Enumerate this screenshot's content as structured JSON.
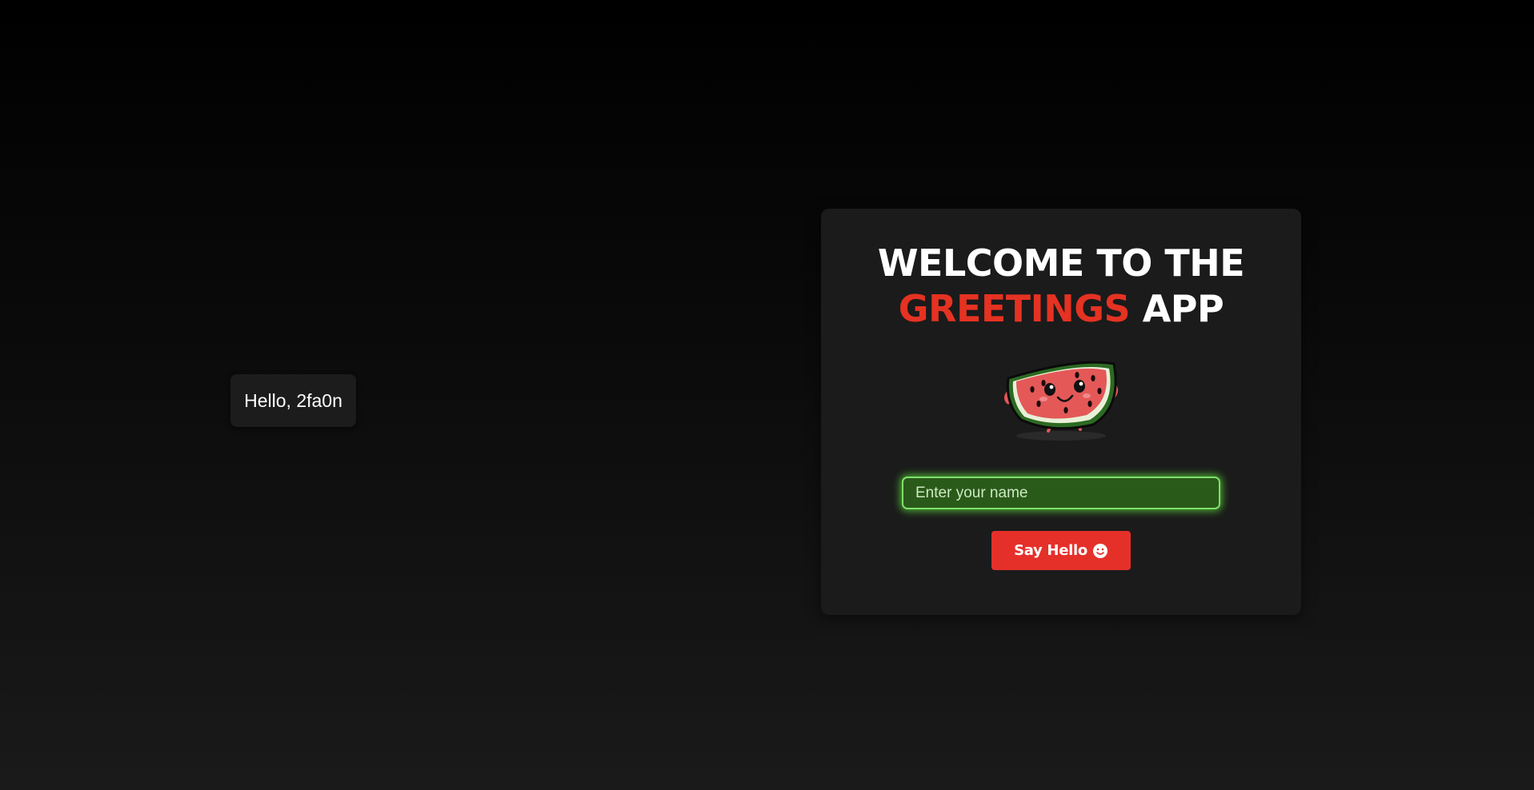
{
  "greeting": {
    "text": "Hello, 2fa0n"
  },
  "card": {
    "title_line1": "WELCOME TO THE",
    "title_accent": "GREETINGS",
    "title_rest": "APP",
    "mascot_icon": "watermelon-mascot",
    "input": {
      "value": "",
      "placeholder": "Enter your name"
    },
    "button": {
      "label": "Say Hello",
      "icon": "smile-icon"
    }
  },
  "colors": {
    "accent": "#e53222",
    "button": "#e5302a",
    "input_bg": "#2a5a1a",
    "input_glow": "#7ee06a",
    "card_bg": "#1b1b1b"
  }
}
